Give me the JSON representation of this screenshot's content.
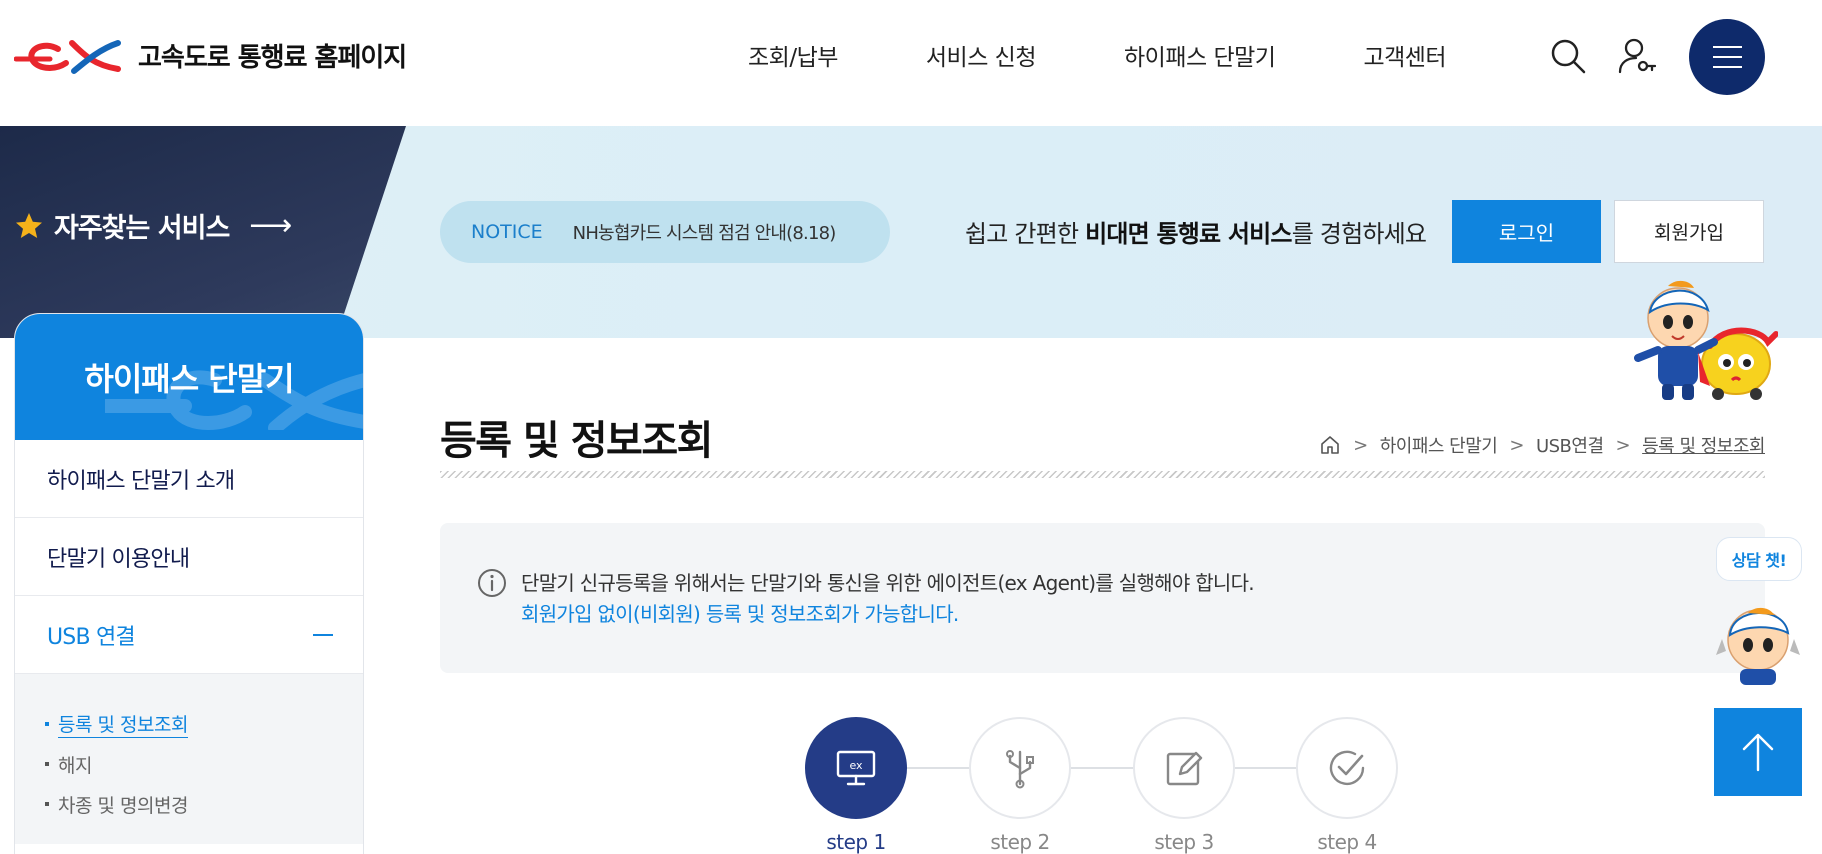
{
  "header": {
    "logo_text": "고속도로 통행료 홈페이지",
    "nav": [
      "조회/납부",
      "서비스 신청",
      "하이패스 단말기",
      "고객센터"
    ]
  },
  "banner": {
    "favorites": "자주찾는 서비스",
    "notice_tag": "NOTICE",
    "notice_text": "NH농협카드 시스템 점검 안내(8.18)",
    "promo_prefix": "쉽고 간편한 ",
    "promo_bold": "비대면 통행료 서비스",
    "promo_suffix": "를 경험하세요",
    "login": "로그인",
    "join": "회원가입"
  },
  "lnb": {
    "title": "하이패스 단말기",
    "items": [
      {
        "label": "하이패스 단말기 소개"
      },
      {
        "label": "단말기 이용안내"
      },
      {
        "label": "USB 연결"
      }
    ],
    "subitems": [
      "등록 및 정보조회",
      "해지",
      "차종 및 명의변경"
    ]
  },
  "content": {
    "title": "등록 및 정보조회",
    "breadcrumb": [
      "하이패스 단말기",
      "USB연결",
      "등록 및 정보조회"
    ],
    "info_line1": "단말기 신규등록을 위해서는 단말기와 통신을 위한 에이전트(ex Agent)를 실행해야 합니다.",
    "info_line2": "회원가입 없이(비회원) 등록 및 정보조회가 가능합니다.",
    "steps": [
      "step 1",
      "step 2",
      "step 3",
      "step 4"
    ]
  },
  "floating": {
    "chat_label": "상담 챗!"
  },
  "colors": {
    "primary": "#0f84de",
    "navy": "#0e2a6b",
    "step_active": "#243c87",
    "logo_red": "#e8262d",
    "logo_blue": "#1466b8"
  }
}
